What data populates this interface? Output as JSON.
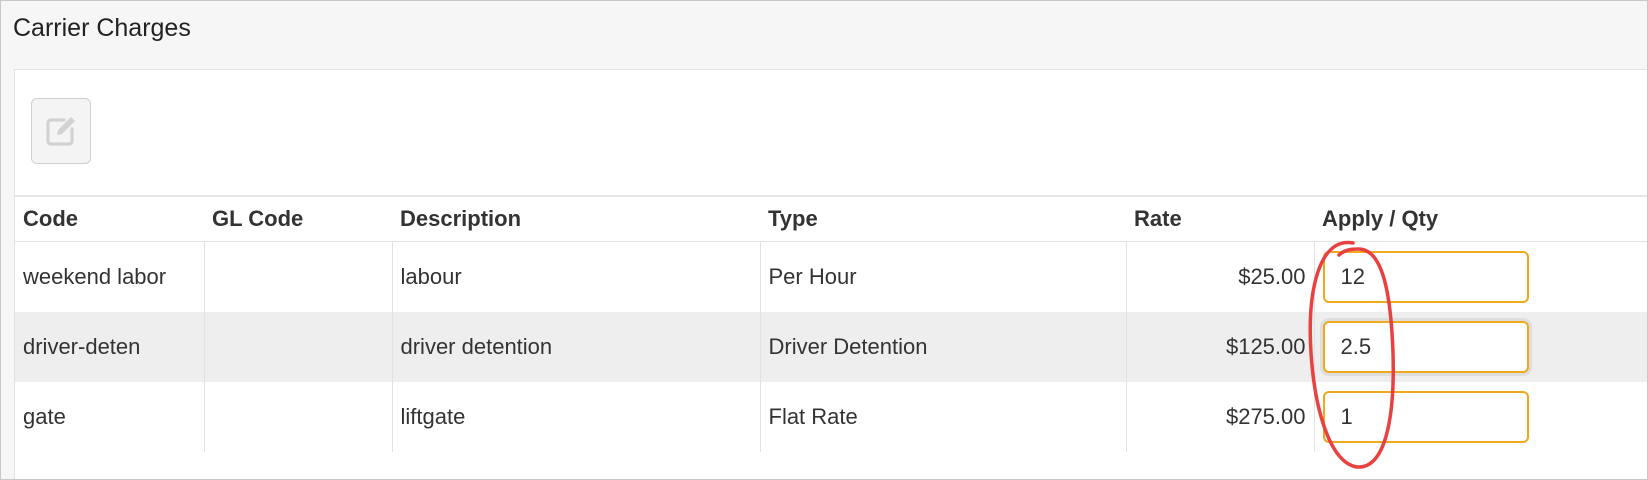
{
  "panel": {
    "title": "Carrier Charges"
  },
  "toolbar": {
    "edit_icon": "edit-icon"
  },
  "table": {
    "columns": [
      "Code",
      "GL Code",
      "Description",
      "Type",
      "Rate",
      "Apply / Qty"
    ],
    "rows": [
      {
        "code": "weekend labor",
        "gl_code": "",
        "description": "labour",
        "type": "Per Hour",
        "rate": "$25.00",
        "qty": "12"
      },
      {
        "code": "driver-deten",
        "gl_code": "",
        "description": "driver detention",
        "type": "Driver Detention",
        "rate": "$125.00",
        "qty": "2.5"
      },
      {
        "code": "gate",
        "gl_code": "",
        "description": "liftgate",
        "type": "Flat Rate",
        "rate": "$275.00",
        "qty": "1"
      }
    ]
  },
  "colors": {
    "input_border": "#f0a81c",
    "annotation": "#e8413f",
    "row_alt": "#eeeeee"
  }
}
